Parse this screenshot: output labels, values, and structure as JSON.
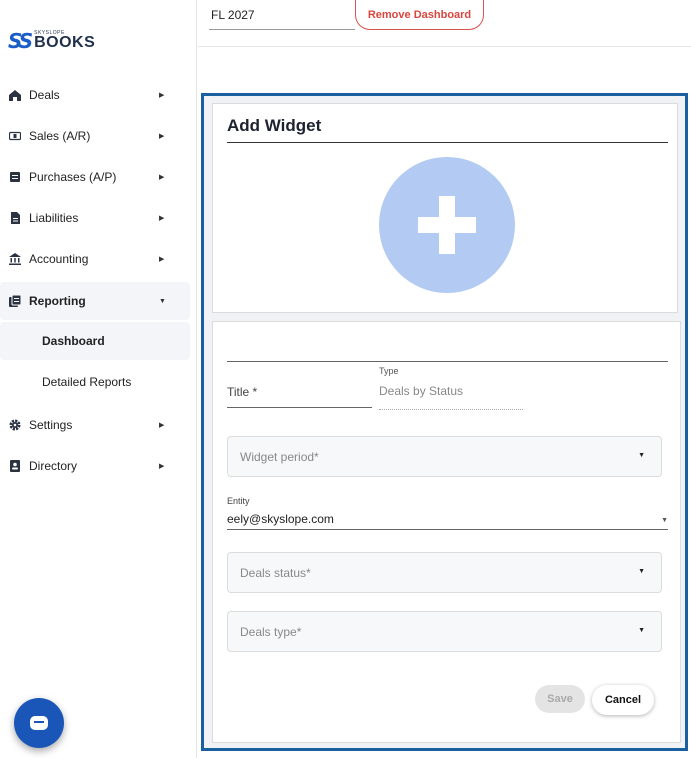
{
  "logo": {
    "mark": "SS",
    "small": "SKYSLOPE",
    "big": "BOOKS"
  },
  "sidebar": {
    "items": [
      {
        "label": "Deals",
        "icon": "house-icon"
      },
      {
        "label": "Sales (A/R)",
        "icon": "dollar-bill-icon"
      },
      {
        "label": "Purchases (A/P)",
        "icon": "receipt-icon"
      },
      {
        "label": "Liabilities",
        "icon": "document-icon"
      },
      {
        "label": "Accounting",
        "icon": "bank-icon"
      },
      {
        "label": "Reporting",
        "icon": "report-icon"
      },
      {
        "label": "Settings",
        "icon": "gear-icon"
      },
      {
        "label": "Directory",
        "icon": "contacts-icon"
      }
    ],
    "subitems": [
      {
        "label": "Dashboard"
      },
      {
        "label": "Detailed Reports"
      }
    ]
  },
  "topbar": {
    "dashboard_value": "FL 2027",
    "remove_label": "Remove Dashboard"
  },
  "widget": {
    "heading": "Add Widget",
    "title_label": "Title *",
    "type_caption": "Type",
    "type_value": "Deals by Status",
    "period_placeholder": "Widget period*",
    "entity_caption": "Entity",
    "entity_value": "eely@skyslope.com",
    "status_placeholder": "Deals status*",
    "dealtype_placeholder": "Deals type*",
    "save_label": "Save",
    "cancel_label": "Cancel"
  },
  "colors": {
    "brand": "#1a56b8",
    "frame": "#1a5fa0",
    "danger": "#d9453f",
    "plus_circle": "#b3cbf2"
  }
}
